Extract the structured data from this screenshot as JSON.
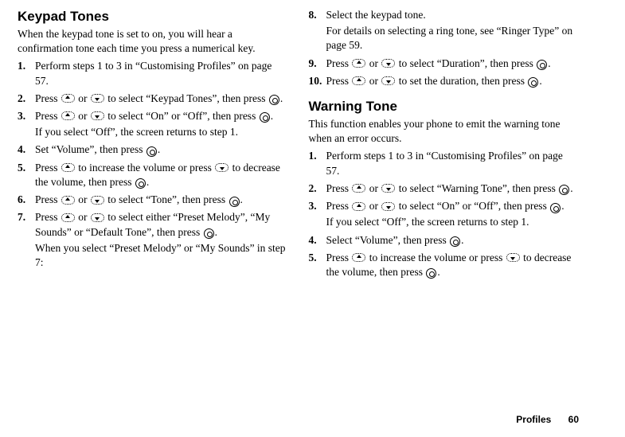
{
  "left": {
    "heading": "Keypad Tones",
    "intro": "When the keypad tone is set to on, you will hear a confirmation tone each time you press a numerical key.",
    "steps": [
      {
        "num": "1.",
        "parts": [
          "Perform steps 1 to 3 in “Customising Profiles” on page 57."
        ]
      },
      {
        "num": "2.",
        "parts": [
          "Press ",
          {
            "btn": "up"
          },
          " or ",
          {
            "btn": "down"
          },
          " to select “Keypad Tones”, then press ",
          {
            "btn": "round"
          },
          "."
        ]
      },
      {
        "num": "3.",
        "parts": [
          "Press ",
          {
            "btn": "up"
          },
          " or ",
          {
            "btn": "down"
          },
          " to select “On” or “Off”, then press ",
          {
            "btn": "round"
          },
          "."
        ],
        "sub": "If you select “Off”, the screen returns to step 1."
      },
      {
        "num": "4.",
        "parts": [
          "Set “Volume”, then press ",
          {
            "btn": "round"
          },
          "."
        ]
      },
      {
        "num": "5.",
        "parts": [
          "Press ",
          {
            "btn": "up"
          },
          " to increase the volume or press ",
          {
            "btn": "down"
          },
          " to decrease the volume, then press ",
          {
            "btn": "round"
          },
          "."
        ]
      },
      {
        "num": "6.",
        "parts": [
          "Press ",
          {
            "btn": "up"
          },
          " or ",
          {
            "btn": "down"
          },
          " to select “Tone”, then press ",
          {
            "btn": "round"
          },
          "."
        ]
      },
      {
        "num": "7.",
        "parts": [
          "Press ",
          {
            "btn": "up"
          },
          " or ",
          {
            "btn": "down"
          },
          " to select either “Preset Melody”, “My Sounds” or “Default Tone”, then press ",
          {
            "btn": "round"
          },
          "."
        ],
        "sub": "When you select “Preset Melody” or “My Sounds” in step 7:"
      }
    ]
  },
  "rightTop": {
    "steps": [
      {
        "num": "8.",
        "parts": [
          "Select the keypad tone."
        ],
        "sub": "For details on selecting a ring tone, see “Ringer Type” on page 59."
      },
      {
        "num": "9.",
        "parts": [
          "Press ",
          {
            "btn": "up"
          },
          " or ",
          {
            "btn": "down"
          },
          " to select “Duration”, then press ",
          {
            "btn": "round"
          },
          "."
        ]
      },
      {
        "num": "10.",
        "parts": [
          "Press ",
          {
            "btn": "up"
          },
          " or ",
          {
            "btn": "down"
          },
          " to set the duration, then press ",
          {
            "btn": "round"
          },
          "."
        ]
      }
    ]
  },
  "rightBottom": {
    "heading": "Warning Tone",
    "intro": "This function enables your phone to emit the warning tone when an error occurs.",
    "steps": [
      {
        "num": "1.",
        "parts": [
          "Perform steps 1 to 3 in “Customising Profiles” on page 57."
        ]
      },
      {
        "num": "2.",
        "parts": [
          "Press ",
          {
            "btn": "up"
          },
          " or ",
          {
            "btn": "down"
          },
          " to select “Warning Tone”, then press ",
          {
            "btn": "round"
          },
          "."
        ]
      },
      {
        "num": "3.",
        "parts": [
          "Press ",
          {
            "btn": "up"
          },
          " or ",
          {
            "btn": "down"
          },
          " to select “On” or “Off”, then press ",
          {
            "btn": "round"
          },
          "."
        ],
        "sub": "If you select “Off”, the screen returns to step 1."
      },
      {
        "num": "4.",
        "parts": [
          "Select “Volume”, then press ",
          {
            "btn": "round"
          },
          "."
        ]
      },
      {
        "num": "5.",
        "parts": [
          "Press ",
          {
            "btn": "up"
          },
          " to increase the volume or press ",
          {
            "btn": "down"
          },
          " to decrease the volume, then press ",
          {
            "btn": "round"
          },
          "."
        ]
      }
    ]
  },
  "footer": {
    "section": "Profiles",
    "page": "60"
  }
}
